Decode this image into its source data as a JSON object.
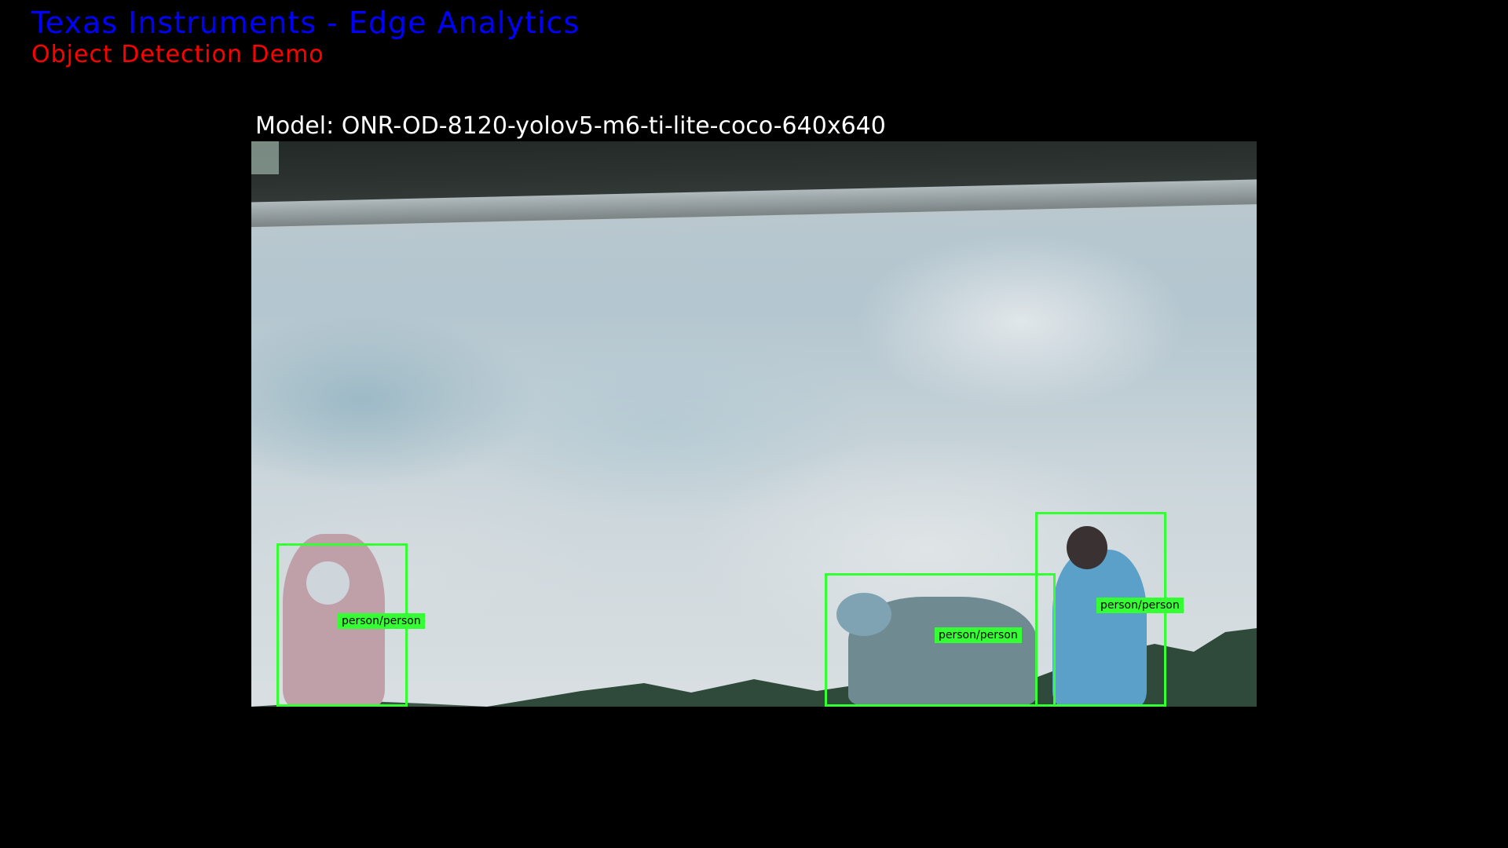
{
  "header": {
    "title": "Texas Instruments - Edge Analytics",
    "title_color": "#0000ff",
    "subtitle": "Object Detection Demo",
    "subtitle_color": "#ff0000"
  },
  "model": {
    "label": "Model: ONR-OD-8120-yolov5-m6-ti-lite-coco-640x640"
  },
  "detections": [
    {
      "label": "person/person"
    },
    {
      "label": "person/person"
    },
    {
      "label": "person/person"
    }
  ],
  "colors": {
    "background": "#000000",
    "box": "#33ff33",
    "label_text": "#000000"
  }
}
